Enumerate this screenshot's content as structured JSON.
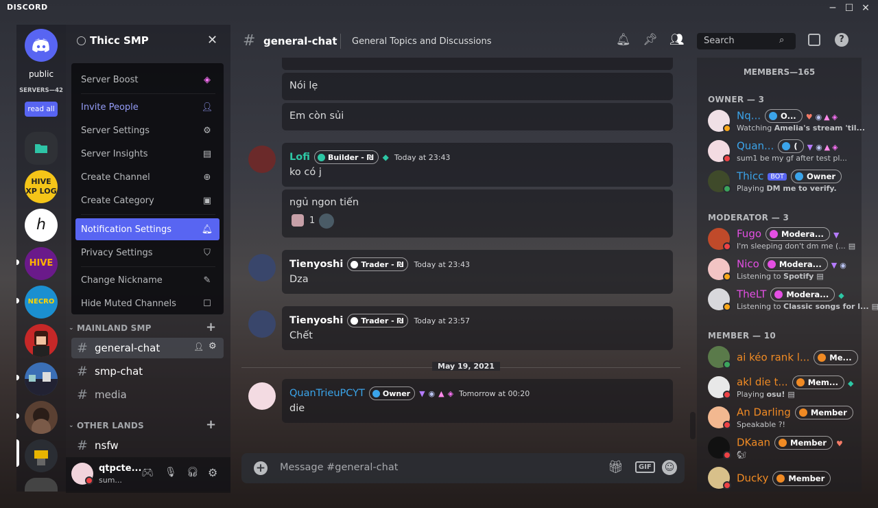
{
  "app": {
    "logo": "DISCORD"
  },
  "rail": {
    "top_label": "public",
    "servers_count": "SERVERS—42",
    "read_all": "read all"
  },
  "server": {
    "name": "Thicc SMP"
  },
  "menu": [
    {
      "label": "Server Boost",
      "icon": "boost-icon"
    },
    {
      "label": "Invite People",
      "icon": "add-person-icon"
    },
    {
      "label": "Server Settings",
      "icon": "gear-icon"
    },
    {
      "label": "Server Insights",
      "icon": "insights-icon"
    },
    {
      "label": "Create Channel",
      "icon": "plus-circle-icon"
    },
    {
      "label": "Create Category",
      "icon": "folder-plus-icon"
    },
    {
      "label": "Notification Settings",
      "icon": "bell-icon"
    },
    {
      "label": "Privacy Settings",
      "icon": "shield-icon"
    },
    {
      "label": "Change Nickname",
      "icon": "pencil-icon"
    },
    {
      "label": "Hide Muted Channels",
      "icon": "checkbox-icon"
    }
  ],
  "categories": [
    {
      "name": "MAINLAND SMP",
      "channels": [
        "general-chat",
        "smp-chat",
        "media"
      ]
    },
    {
      "name": "OTHER LANDS",
      "channels": [
        "nsfw"
      ]
    }
  ],
  "user": {
    "name": "qtpcte...",
    "status": "sum..."
  },
  "header": {
    "channel": "general-chat",
    "topic": "General Topics and Discussions",
    "search_placeholder": "Search"
  },
  "messages": {
    "m0": "Nói lẹ",
    "m1": "Em còn sủi",
    "lofi": {
      "name": "Lofi",
      "role": "Builder - ₪",
      "time": "Today at 23:43",
      "text": "ko có j",
      "text2": "ngủ ngon tiến",
      "reaction_count": "1"
    },
    "tien1": {
      "name": "Tienyoshi",
      "role": "Trader - ₪",
      "time": "Today at 23:43",
      "text": "Dza"
    },
    "tien2": {
      "name": "Tienyoshi",
      "role": "Trader - ₪",
      "time": "Today at 23:57",
      "text": "Chết"
    },
    "divider": "May 19, 2021",
    "quan": {
      "name": "QuanTrieuPCYT",
      "role": "Owner",
      "time": "Tomorrow at 00:20",
      "text": "die"
    }
  },
  "composer": {
    "placeholder": "Message #general-chat",
    "gif": "GIF"
  },
  "members": {
    "title": "MEMBERS—165",
    "groups": [
      {
        "label": "OWNER — 3",
        "items": [
          {
            "name": "Nq...",
            "badge": "O...",
            "activity_pre": "Watching ",
            "activity_bold": "Amelia's stream 'til..."
          },
          {
            "name": "Quan...",
            "badge": "(",
            "activity_pre": "",
            "activity_bold": "sum1 be my gf after test pl..."
          },
          {
            "name": "Thicc",
            "bot": "BOT",
            "badge": "Owner",
            "activity_pre": "Playing ",
            "activity_bold": "DM me to verify."
          }
        ]
      },
      {
        "label": "MODERATOR — 3",
        "items": [
          {
            "name": "Fugo",
            "badge": "Modera...",
            "activity_pre": "",
            "activity_bold": "I'm sleeping don't dm me (..."
          },
          {
            "name": "Nico",
            "badge": "Modera...",
            "activity_pre": "Listening to ",
            "activity_bold": "Spotify"
          },
          {
            "name": "TheLT",
            "badge": "Modera...",
            "activity_pre": "Listening to ",
            "activity_bold": "Classic songs for l..."
          }
        ]
      },
      {
        "label": "MEMBER — 10",
        "items": [
          {
            "name": "ai kéo rank l...",
            "badge": "Me...",
            "activity_pre": "",
            "activity_bold": ""
          },
          {
            "name": "akl die t...",
            "badge": "Mem...",
            "activity_pre": "Playing ",
            "activity_bold": "osu!"
          },
          {
            "name": "An Darling",
            "badge": "Member",
            "activity_pre": "",
            "activity_bold": "Speakable ?!"
          },
          {
            "name": "DKaan",
            "badge": "Member",
            "activity_pre": "",
            "activity_bold": "🐿"
          },
          {
            "name": "Ducky",
            "badge": "Member",
            "activity_pre": "",
            "activity_bold": ""
          }
        ]
      }
    ]
  },
  "colors": {
    "blurple": "#5865f2",
    "owner": "#3ba4ea",
    "moderator": "#e44fe3",
    "member": "#f08a24",
    "online": "#3ba55d",
    "dnd": "#ed4245",
    "idle": "#faa81a"
  }
}
